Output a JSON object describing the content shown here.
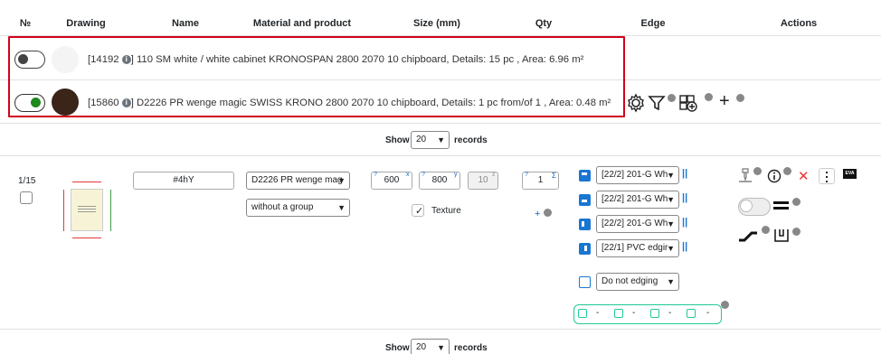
{
  "headers": [
    "№",
    "Drawing",
    "Name",
    "Material and product",
    "Size (mm)",
    "Qty",
    "Edge",
    "Actions"
  ],
  "materials": [
    {
      "id_text": "[14192",
      "rest": "] 110 SM white / white cabinet KRONOSPAN 2800 2070 10 chipboard, Details: 15 pc , Area: 6.96 m²",
      "active": false,
      "swatch_color": "#f4f4f4"
    },
    {
      "id_text": "[15860",
      "rest": "] D2226 PR wenge magic SWISS KRONO 2800 2070 10 chipboard, Details: 1 pc from/of 1 , Area: 0.48 m²",
      "active": true,
      "swatch_color": "#3b2418"
    }
  ],
  "info_glyph": "i",
  "pager_top": {
    "show": "Show",
    "value": "20",
    "records": "records"
  },
  "pager_bottom": {
    "show": "Show",
    "value": "20",
    "records": "records"
  },
  "row": {
    "number": "1/15",
    "name_value": "#4hY",
    "material_select": "D2226 PR wenge mag",
    "group_select": "without a group",
    "size": {
      "w_label": "?",
      "w": "600",
      "w_sup": "x",
      "h_label": "?",
      "h": "800",
      "h_sup": "y",
      "t": "10",
      "t_sup": "z"
    },
    "texture_label": "Texture",
    "texture_checked": true,
    "qty": {
      "label": "?",
      "value": "1",
      "sigma": "Σ"
    },
    "plus": "+",
    "edges": [
      {
        "value": "[22/2] 201-G Wh"
      },
      {
        "value": "[22/2] 201-G Wh"
      },
      {
        "value": "[22/2] 201-G Wh"
      },
      {
        "value": "[22/1] PVC edgir"
      }
    ],
    "edge_bars": "||",
    "edging_select": "Do not edging",
    "edge_summary": [
      "-",
      "-",
      "-",
      "-"
    ],
    "eva_label": "EVA"
  },
  "colors": {
    "accent_red": "#d0021b",
    "edge_blue": "#1976d2",
    "toggle_on": "#1e8a1e",
    "teal": "#20c997"
  }
}
